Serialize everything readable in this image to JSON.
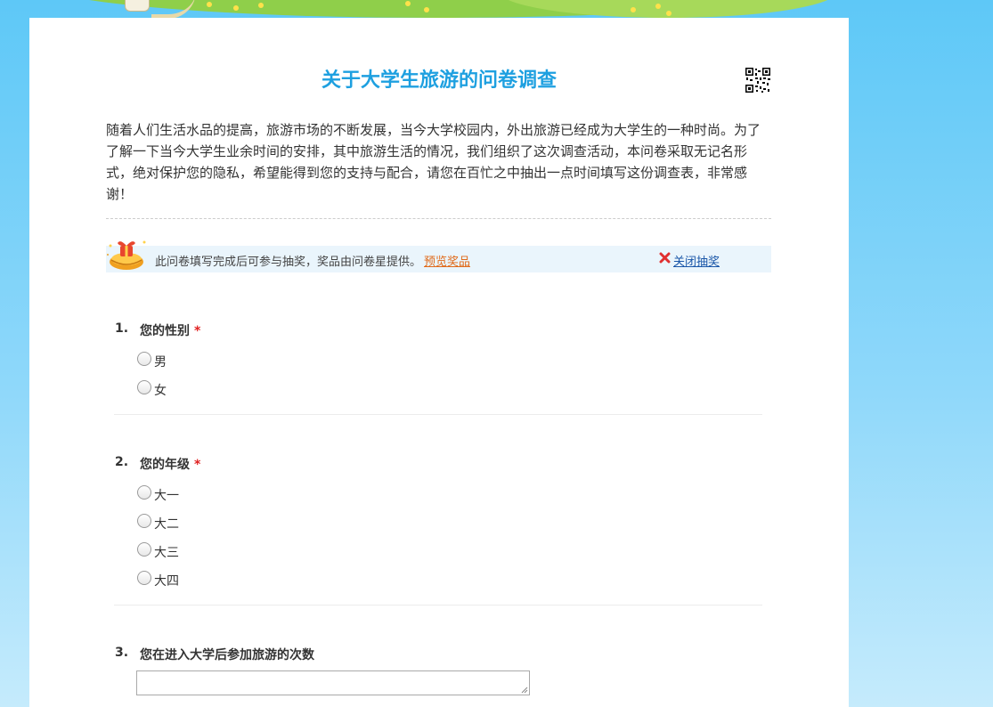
{
  "survey": {
    "title": "关于大学生旅游的问卷调查",
    "intro": "随着人们生活水品的提高，旅游市场的不断发展，当今大学校园内，外出旅游已经成为大学生的一种时尚。为了了解一下当今大学生业余时间的安排，其中旅游生活的情况，我们组织了这次调查活动，本问卷采取无记名形式，绝对保护您的隐私，希望能得到您的支持与配合，请您在百忙之中抽出一点时间填写这份调查表，非常感谢！"
  },
  "lottery": {
    "text": "此问卷填写完成后可参与抽奖，奖品由问卷星提供。",
    "preview_link": "预览奖品",
    "close_link": "关闭抽奖"
  },
  "questions": [
    {
      "number": "1.",
      "title": "您的性别",
      "required_mark": "*",
      "options": [
        "男",
        "女"
      ]
    },
    {
      "number": "2.",
      "title": "您的年级",
      "required_mark": "*",
      "options": [
        "大一",
        "大二",
        "大三",
        "大四"
      ]
    },
    {
      "number": "3.",
      "title": "您在进入大学后参加旅游的次数",
      "answer_value": ""
    }
  ],
  "colors": {
    "title": "#1ea0e0",
    "required": "#e02020",
    "preview_link": "#e06a1a",
    "close_link": "#1a56a8",
    "lottery_bar": "#eaf5fc"
  },
  "icons": {
    "qr": "qr-code-icon",
    "lottery": "lottery-gift-icon",
    "close": "close-x-icon"
  }
}
